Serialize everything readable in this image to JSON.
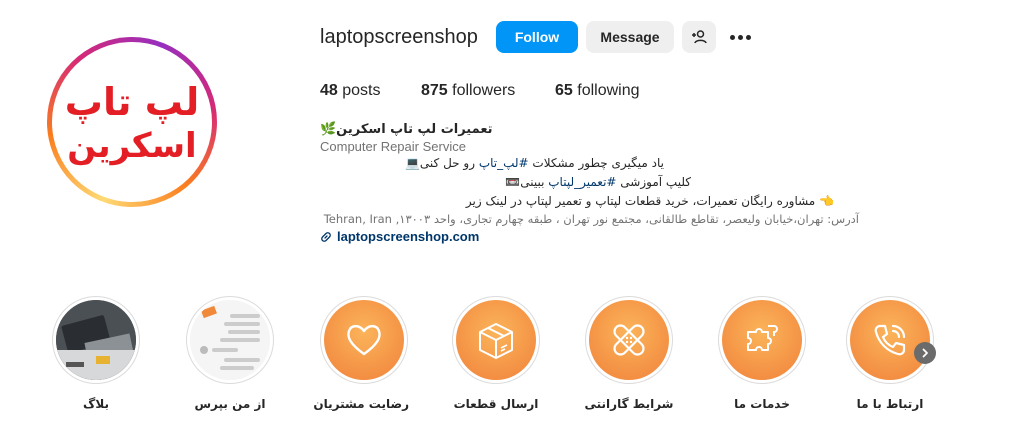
{
  "profile": {
    "username": "laptopscreenshop",
    "follow_label": "Follow",
    "message_label": "Message",
    "stats": {
      "posts_count": "48",
      "posts_label": "posts",
      "followers_count": "875",
      "followers_label": "followers",
      "following_count": "65",
      "following_label": "following"
    },
    "bio": {
      "name": "تعمیرات لپ تاپ اسکرین🌿",
      "category": "Computer Repair Service",
      "line1_text": "یاد میگیری چطور مشکلات ",
      "line1_tag": "#لپ_تاپ",
      "line1_tail": " رو حل کنی💻",
      "line2_text": "کلیپ آموزشی ",
      "line2_tag": "#تعمیر_لپتاپ",
      "line2_tail": " ببینی📼",
      "line3": "👈 مشاوره رایگان تعمیرات، خرید قطعات لپتاپ و تعمیر لپتاپ در لینک زیر",
      "address": "آدرس: تهران،خیابان ولیعصر، تقاطع طالقانی، مجتمع نور تهران ، طبقه چهارم تجاری، واحد ۱۳۰۰۳, Tehran, Iran",
      "link": "laptopscreenshop.com"
    },
    "avatar_logo_text": [
      "لپ تاپ",
      "اسکرین"
    ],
    "colors": {
      "primary_button": "#0095f6",
      "secondary_button": "#efefef",
      "link": "#00376b",
      "highlight_orange": "#f58a3c",
      "logo_red": "#e31e24"
    }
  },
  "highlights": [
    {
      "label": "بلاگ",
      "icon": "laptop-photo"
    },
    {
      "label": "از من بپرس",
      "icon": "chat-screenshot"
    },
    {
      "label": "رضایت مشتریان",
      "icon": "heart-icon"
    },
    {
      "label": "ارسال قطعات",
      "icon": "box-icon"
    },
    {
      "label": "شرایط گارانتی",
      "icon": "bandage-icon"
    },
    {
      "label": "خدمات ما",
      "icon": "puzzle-icon"
    },
    {
      "label": "ارتباط با ما",
      "icon": "phone-icon"
    }
  ]
}
